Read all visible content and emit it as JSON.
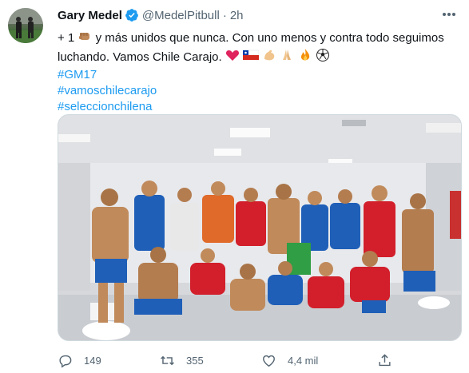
{
  "author": {
    "name": "Gary Medel",
    "handle": "@MedelPitbull",
    "separator": "·",
    "time": "2h"
  },
  "tweet": {
    "line1_prefix": "+ 1",
    "line1_rest": "y más unidos que nunca. Con uno menos y contra todo seguimos",
    "line2": "luchando. Vamos Chile Carajo.",
    "hashtags": [
      "#GM17",
      "#vamoschilecarajo",
      "#seleccionchilena"
    ]
  },
  "actions": {
    "replies": "149",
    "retweets": "355",
    "likes": "4,4 mil"
  },
  "icons": {
    "verified": "verified-badge-icon",
    "more": "more-options-icon",
    "reply": "reply-icon",
    "retweet": "retweet-icon",
    "like": "heart-icon",
    "share": "share-icon"
  },
  "colors": {
    "accent": "#1d9bf0",
    "muted": "#536471",
    "jersey_red": "#d21f2b",
    "shorts_blue": "#1f5fb8"
  }
}
